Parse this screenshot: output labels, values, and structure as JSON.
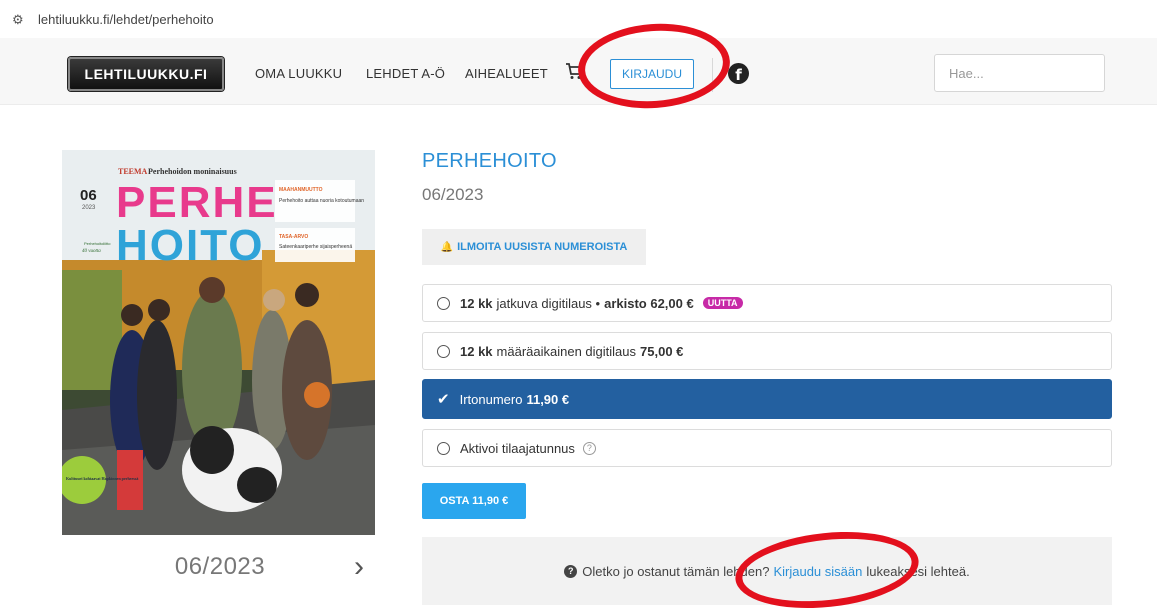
{
  "browser": {
    "url": "lehtiluukku.fi/lehdet/perhehoito"
  },
  "header": {
    "logo": "LEHTILUUKKU.FI",
    "nav": [
      "OMA LUUKKU",
      "LEHDET A-Ö",
      "AIHEALUEET"
    ],
    "login_label": "KIRJAUDU",
    "search_placeholder": "Hae..."
  },
  "cover": {
    "theme_label": "TEEMA",
    "theme_text": "Perhehoidon moninaisuus",
    "issue_number": "06",
    "issue_year": "2023",
    "masthead_line1": "PERHE",
    "masthead_line2": "HOITO",
    "box1_title": "MAAHANMUUTTO",
    "box1_text": "Perhehoito auttaa nuoria kotoutumaan",
    "box2_title": "TASA-ARVO",
    "box2_text": "Sateenkaariperhe sijaisperheenä",
    "publisher": "Perhehoitoliitto",
    "publisher_years": "40 vuotta",
    "sticker_text": "Kulttuuri kohtaavat Hapkinnen perheessä"
  },
  "cover_caption": "06/2023",
  "product": {
    "title": "PERHEHOITO",
    "issue": "06/2023",
    "notify_label": "ILMOITA UUSISTA NUMEROISTA",
    "options": [
      {
        "bold": "12 kk",
        "text": "jatkuva digitilaus •",
        "extra_bold": "arkisto 62,00 €",
        "badge": "UUTTA"
      },
      {
        "bold": "12 kk",
        "text": "määräaikainen digitilaus",
        "extra_bold": "75,00 €"
      },
      {
        "text": "Irtonumero",
        "extra_bold": "11,90 €"
      },
      {
        "text": "Aktivoi tilaajatunnus"
      }
    ],
    "buy_label": "OSTA 11,90 €",
    "info_pre": "Oletko jo ostanut tämän lehden?",
    "info_link": "Kirjaudu sisään",
    "info_post": "lukeaksesi lehteä."
  },
  "colors": {
    "accent": "#2b8fd6",
    "selected": "#2360a0",
    "buy": "#2aa6ee",
    "badge": "#c72aa7",
    "annotation": "#e3101d"
  }
}
